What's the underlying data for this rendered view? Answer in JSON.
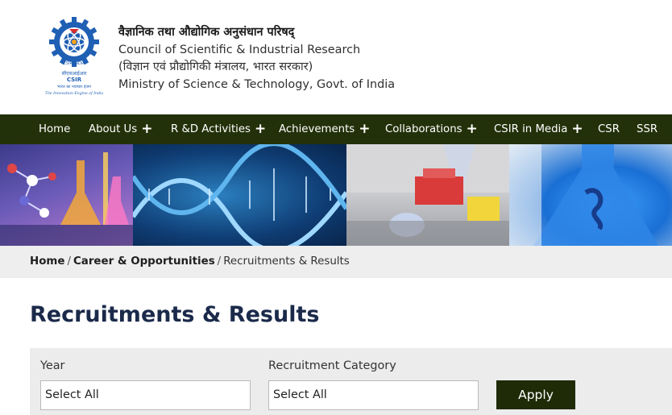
{
  "header": {
    "hindi_title": "वैज्ञानिक तथा औद्योगिक अनुसंधान परिषद्",
    "english_title": "Council of Scientific & Industrial Research",
    "hindi_ministry": "(विज्ञान एवं प्रौद्योगिकी मंत्रालय, भारत सरकार)",
    "english_ministry": "Ministry of Science & Technology, Govt. of India",
    "logo": {
      "hindi_name": "सीएसआईआर",
      "english_name": "CSIR",
      "hindi_tagline": "भारत का नवाचार इंजन",
      "english_tagline": "The Innovation Engine of India",
      "badge_text": "CSIR-INDIA"
    }
  },
  "nav": {
    "items": [
      {
        "label": "Home",
        "has_submenu": false
      },
      {
        "label": "About Us",
        "has_submenu": true
      },
      {
        "label": "R &D Activities",
        "has_submenu": true
      },
      {
        "label": "Achievements",
        "has_submenu": true
      },
      {
        "label": "Collaborations",
        "has_submenu": true
      },
      {
        "label": "CSIR in Media",
        "has_submenu": true
      },
      {
        "label": "CSR",
        "has_submenu": false
      },
      {
        "label": "SSR",
        "has_submenu": false
      }
    ],
    "submenu_glyph": "+"
  },
  "breadcrumb": {
    "items": [
      "Home",
      "Career & Opportunities",
      "Recruitments & Results"
    ],
    "separator": "/"
  },
  "page": {
    "title": "Recruitments & Results"
  },
  "filter": {
    "year_label": "Year",
    "year_value": "Select All",
    "category_label": "Recruitment Category",
    "category_value": "Select All",
    "apply_label": "Apply"
  },
  "colors": {
    "nav_bg": "#23310a",
    "apply_bg": "#1f2a06",
    "title_color": "#1b2a4a",
    "logo_blue": "#1f5fb4",
    "breadcrumb_bg": "#eeeeee"
  }
}
